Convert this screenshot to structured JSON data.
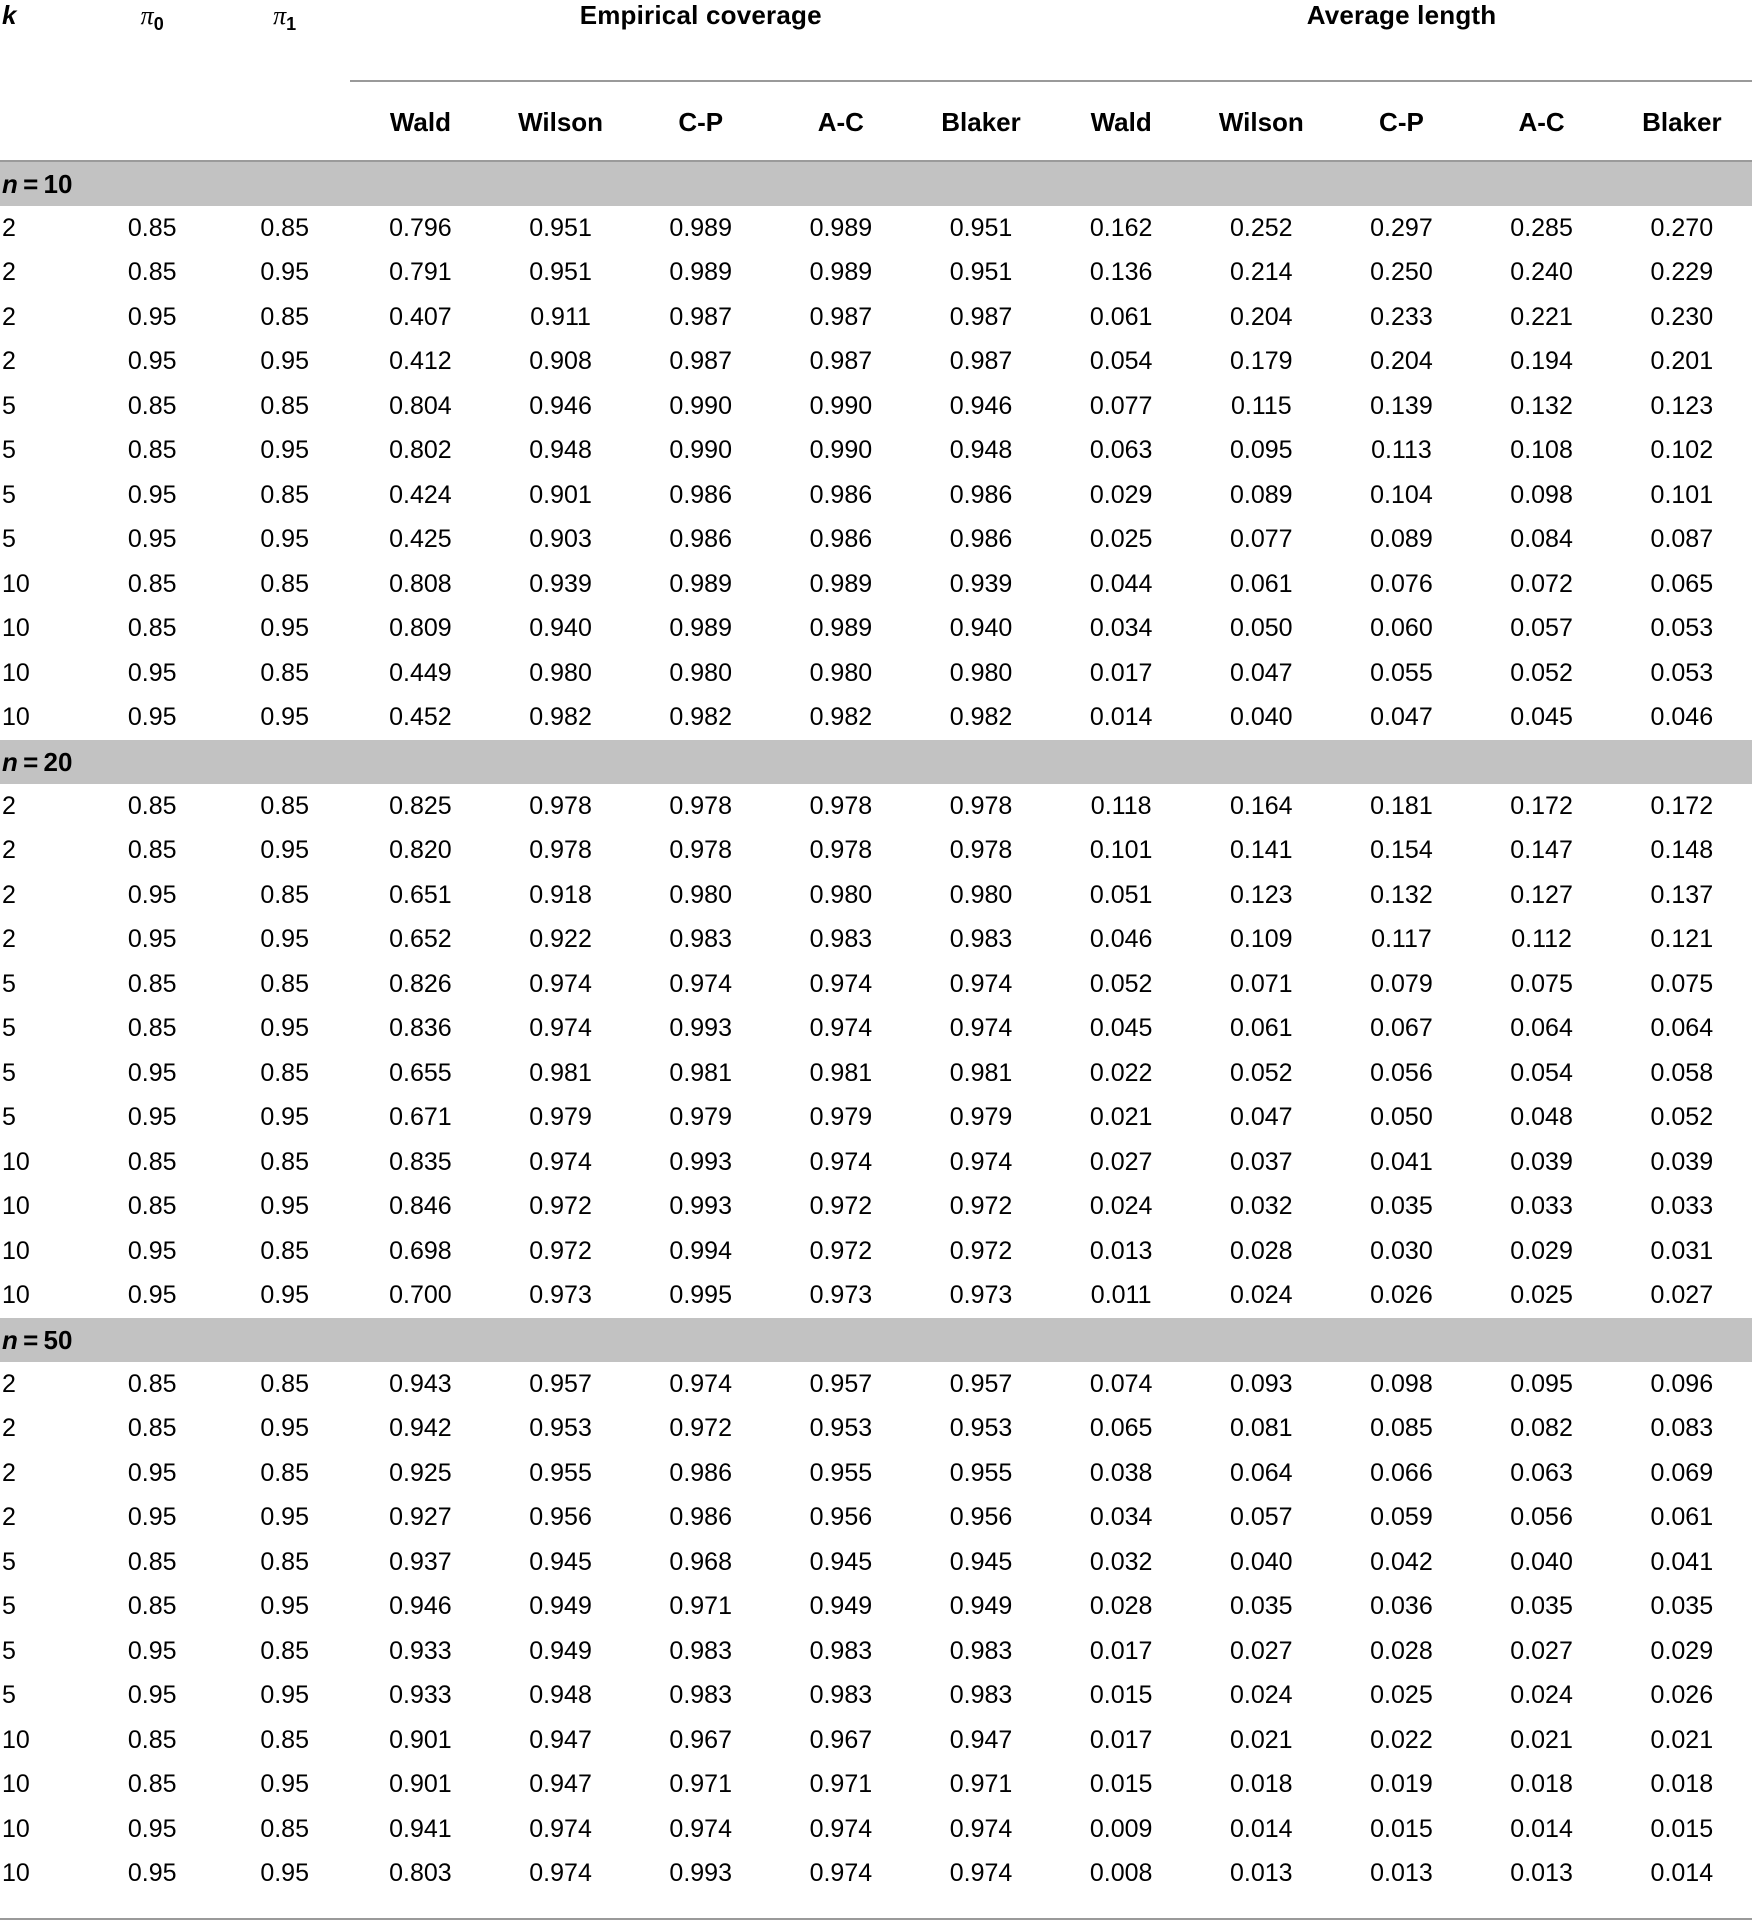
{
  "table": {
    "index_headers": [
      "k",
      "π0",
      "π1"
    ],
    "index_header_labels": {
      "k": "k",
      "pi0_base": "π",
      "pi0_sub": "0",
      "pi1_base": "π",
      "pi1_sub": "1"
    },
    "group_headers": [
      "Empirical coverage",
      "Average length"
    ],
    "method_headers": [
      "Wald",
      "Wilson",
      "C-P",
      "A-C",
      "Blaker"
    ],
    "sections": [
      {
        "label_prefix": "n",
        "label_eq": "=",
        "label_value": "10",
        "label": "n = 10",
        "rows": [
          {
            "k": "2",
            "pi0": "0.85",
            "pi1": "0.85",
            "coverage": [
              "0.796",
              "0.951",
              "0.989",
              "0.989",
              "0.951"
            ],
            "length": [
              "0.162",
              "0.252",
              "0.297",
              "0.285",
              "0.270"
            ]
          },
          {
            "k": "2",
            "pi0": "0.85",
            "pi1": "0.95",
            "coverage": [
              "0.791",
              "0.951",
              "0.989",
              "0.989",
              "0.951"
            ],
            "length": [
              "0.136",
              "0.214",
              "0.250",
              "0.240",
              "0.229"
            ]
          },
          {
            "k": "2",
            "pi0": "0.95",
            "pi1": "0.85",
            "coverage": [
              "0.407",
              "0.911",
              "0.987",
              "0.987",
              "0.987"
            ],
            "length": [
              "0.061",
              "0.204",
              "0.233",
              "0.221",
              "0.230"
            ]
          },
          {
            "k": "2",
            "pi0": "0.95",
            "pi1": "0.95",
            "coverage": [
              "0.412",
              "0.908",
              "0.987",
              "0.987",
              "0.987"
            ],
            "length": [
              "0.054",
              "0.179",
              "0.204",
              "0.194",
              "0.201"
            ]
          },
          {
            "k": "5",
            "pi0": "0.85",
            "pi1": "0.85",
            "coverage": [
              "0.804",
              "0.946",
              "0.990",
              "0.990",
              "0.946"
            ],
            "length": [
              "0.077",
              "0.115",
              "0.139",
              "0.132",
              "0.123"
            ]
          },
          {
            "k": "5",
            "pi0": "0.85",
            "pi1": "0.95",
            "coverage": [
              "0.802",
              "0.948",
              "0.990",
              "0.990",
              "0.948"
            ],
            "length": [
              "0.063",
              "0.095",
              "0.113",
              "0.108",
              "0.102"
            ]
          },
          {
            "k": "5",
            "pi0": "0.95",
            "pi1": "0.85",
            "coverage": [
              "0.424",
              "0.901",
              "0.986",
              "0.986",
              "0.986"
            ],
            "length": [
              "0.029",
              "0.089",
              "0.104",
              "0.098",
              "0.101"
            ]
          },
          {
            "k": "5",
            "pi0": "0.95",
            "pi1": "0.95",
            "coverage": [
              "0.425",
              "0.903",
              "0.986",
              "0.986",
              "0.986"
            ],
            "length": [
              "0.025",
              "0.077",
              "0.089",
              "0.084",
              "0.087"
            ]
          },
          {
            "k": "10",
            "pi0": "0.85",
            "pi1": "0.85",
            "coverage": [
              "0.808",
              "0.939",
              "0.989",
              "0.989",
              "0.939"
            ],
            "length": [
              "0.044",
              "0.061",
              "0.076",
              "0.072",
              "0.065"
            ]
          },
          {
            "k": "10",
            "pi0": "0.85",
            "pi1": "0.95",
            "coverage": [
              "0.809",
              "0.940",
              "0.989",
              "0.989",
              "0.940"
            ],
            "length": [
              "0.034",
              "0.050",
              "0.060",
              "0.057",
              "0.053"
            ]
          },
          {
            "k": "10",
            "pi0": "0.95",
            "pi1": "0.85",
            "coverage": [
              "0.449",
              "0.980",
              "0.980",
              "0.980",
              "0.980"
            ],
            "length": [
              "0.017",
              "0.047",
              "0.055",
              "0.052",
              "0.053"
            ]
          },
          {
            "k": "10",
            "pi0": "0.95",
            "pi1": "0.95",
            "coverage": [
              "0.452",
              "0.982",
              "0.982",
              "0.982",
              "0.982"
            ],
            "length": [
              "0.014",
              "0.040",
              "0.047",
              "0.045",
              "0.046"
            ]
          }
        ]
      },
      {
        "label_prefix": "n",
        "label_eq": "=",
        "label_value": "20",
        "label": "n = 20",
        "rows": [
          {
            "k": "2",
            "pi0": "0.85",
            "pi1": "0.85",
            "coverage": [
              "0.825",
              "0.978",
              "0.978",
              "0.978",
              "0.978"
            ],
            "length": [
              "0.118",
              "0.164",
              "0.181",
              "0.172",
              "0.172"
            ]
          },
          {
            "k": "2",
            "pi0": "0.85",
            "pi1": "0.95",
            "coverage": [
              "0.820",
              "0.978",
              "0.978",
              "0.978",
              "0.978"
            ],
            "length": [
              "0.101",
              "0.141",
              "0.154",
              "0.147",
              "0.148"
            ]
          },
          {
            "k": "2",
            "pi0": "0.95",
            "pi1": "0.85",
            "coverage": [
              "0.651",
              "0.918",
              "0.980",
              "0.980",
              "0.980"
            ],
            "length": [
              "0.051",
              "0.123",
              "0.132",
              "0.127",
              "0.137"
            ]
          },
          {
            "k": "2",
            "pi0": "0.95",
            "pi1": "0.95",
            "coverage": [
              "0.652",
              "0.922",
              "0.983",
              "0.983",
              "0.983"
            ],
            "length": [
              "0.046",
              "0.109",
              "0.117",
              "0.112",
              "0.121"
            ]
          },
          {
            "k": "5",
            "pi0": "0.85",
            "pi1": "0.85",
            "coverage": [
              "0.826",
              "0.974",
              "0.974",
              "0.974",
              "0.974"
            ],
            "length": [
              "0.052",
              "0.071",
              "0.079",
              "0.075",
              "0.075"
            ]
          },
          {
            "k": "5",
            "pi0": "0.85",
            "pi1": "0.95",
            "coverage": [
              "0.836",
              "0.974",
              "0.993",
              "0.974",
              "0.974"
            ],
            "length": [
              "0.045",
              "0.061",
              "0.067",
              "0.064",
              "0.064"
            ]
          },
          {
            "k": "5",
            "pi0": "0.95",
            "pi1": "0.85",
            "coverage": [
              "0.655",
              "0.981",
              "0.981",
              "0.981",
              "0.981"
            ],
            "length": [
              "0.022",
              "0.052",
              "0.056",
              "0.054",
              "0.058"
            ]
          },
          {
            "k": "5",
            "pi0": "0.95",
            "pi1": "0.95",
            "coverage": [
              "0.671",
              "0.979",
              "0.979",
              "0.979",
              "0.979"
            ],
            "length": [
              "0.021",
              "0.047",
              "0.050",
              "0.048",
              "0.052"
            ]
          },
          {
            "k": "10",
            "pi0": "0.85",
            "pi1": "0.85",
            "coverage": [
              "0.835",
              "0.974",
              "0.993",
              "0.974",
              "0.974"
            ],
            "length": [
              "0.027",
              "0.037",
              "0.041",
              "0.039",
              "0.039"
            ]
          },
          {
            "k": "10",
            "pi0": "0.85",
            "pi1": "0.95",
            "coverage": [
              "0.846",
              "0.972",
              "0.993",
              "0.972",
              "0.972"
            ],
            "length": [
              "0.024",
              "0.032",
              "0.035",
              "0.033",
              "0.033"
            ]
          },
          {
            "k": "10",
            "pi0": "0.95",
            "pi1": "0.85",
            "coverage": [
              "0.698",
              "0.972",
              "0.994",
              "0.972",
              "0.972"
            ],
            "length": [
              "0.013",
              "0.028",
              "0.030",
              "0.029",
              "0.031"
            ]
          },
          {
            "k": "10",
            "pi0": "0.95",
            "pi1": "0.95",
            "coverage": [
              "0.700",
              "0.973",
              "0.995",
              "0.973",
              "0.973"
            ],
            "length": [
              "0.011",
              "0.024",
              "0.026",
              "0.025",
              "0.027"
            ]
          }
        ]
      },
      {
        "label_prefix": "n",
        "label_eq": "=",
        "label_value": "50",
        "label": "n = 50",
        "rows": [
          {
            "k": "2",
            "pi0": "0.85",
            "pi1": "0.85",
            "coverage": [
              "0.943",
              "0.957",
              "0.974",
              "0.957",
              "0.957"
            ],
            "length": [
              "0.074",
              "0.093",
              "0.098",
              "0.095",
              "0.096"
            ]
          },
          {
            "k": "2",
            "pi0": "0.85",
            "pi1": "0.95",
            "coverage": [
              "0.942",
              "0.953",
              "0.972",
              "0.953",
              "0.953"
            ],
            "length": [
              "0.065",
              "0.081",
              "0.085",
              "0.082",
              "0.083"
            ]
          },
          {
            "k": "2",
            "pi0": "0.95",
            "pi1": "0.85",
            "coverage": [
              "0.925",
              "0.955",
              "0.986",
              "0.955",
              "0.955"
            ],
            "length": [
              "0.038",
              "0.064",
              "0.066",
              "0.063",
              "0.069"
            ]
          },
          {
            "k": "2",
            "pi0": "0.95",
            "pi1": "0.95",
            "coverage": [
              "0.927",
              "0.956",
              "0.986",
              "0.956",
              "0.956"
            ],
            "length": [
              "0.034",
              "0.057",
              "0.059",
              "0.056",
              "0.061"
            ]
          },
          {
            "k": "5",
            "pi0": "0.85",
            "pi1": "0.85",
            "coverage": [
              "0.937",
              "0.945",
              "0.968",
              "0.945",
              "0.945"
            ],
            "length": [
              "0.032",
              "0.040",
              "0.042",
              "0.040",
              "0.041"
            ]
          },
          {
            "k": "5",
            "pi0": "0.85",
            "pi1": "0.95",
            "coverage": [
              "0.946",
              "0.949",
              "0.971",
              "0.949",
              "0.949"
            ],
            "length": [
              "0.028",
              "0.035",
              "0.036",
              "0.035",
              "0.035"
            ]
          },
          {
            "k": "5",
            "pi0": "0.95",
            "pi1": "0.85",
            "coverage": [
              "0.933",
              "0.949",
              "0.983",
              "0.983",
              "0.983"
            ],
            "length": [
              "0.017",
              "0.027",
              "0.028",
              "0.027",
              "0.029"
            ]
          },
          {
            "k": "5",
            "pi0": "0.95",
            "pi1": "0.95",
            "coverage": [
              "0.933",
              "0.948",
              "0.983",
              "0.983",
              "0.983"
            ],
            "length": [
              "0.015",
              "0.024",
              "0.025",
              "0.024",
              "0.026"
            ]
          },
          {
            "k": "10",
            "pi0": "0.85",
            "pi1": "0.85",
            "coverage": [
              "0.901",
              "0.947",
              "0.967",
              "0.967",
              "0.947"
            ],
            "length": [
              "0.017",
              "0.021",
              "0.022",
              "0.021",
              "0.021"
            ]
          },
          {
            "k": "10",
            "pi0": "0.85",
            "pi1": "0.95",
            "coverage": [
              "0.901",
              "0.947",
              "0.971",
              "0.971",
              "0.971"
            ],
            "length": [
              "0.015",
              "0.018",
              "0.019",
              "0.018",
              "0.018"
            ]
          },
          {
            "k": "10",
            "pi0": "0.95",
            "pi1": "0.85",
            "coverage": [
              "0.941",
              "0.974",
              "0.974",
              "0.974",
              "0.974"
            ],
            "length": [
              "0.009",
              "0.014",
              "0.015",
              "0.014",
              "0.015"
            ]
          },
          {
            "k": "10",
            "pi0": "0.95",
            "pi1": "0.95",
            "coverage": [
              "0.803",
              "0.974",
              "0.993",
              "0.974",
              "0.974"
            ],
            "length": [
              "0.008",
              "0.013",
              "0.013",
              "0.013",
              "0.014"
            ]
          }
        ]
      }
    ],
    "colors": {
      "section_band": "#c2c2c2",
      "rule": "#9a9a9a",
      "text": "#000000",
      "background": "#ffffff"
    }
  }
}
